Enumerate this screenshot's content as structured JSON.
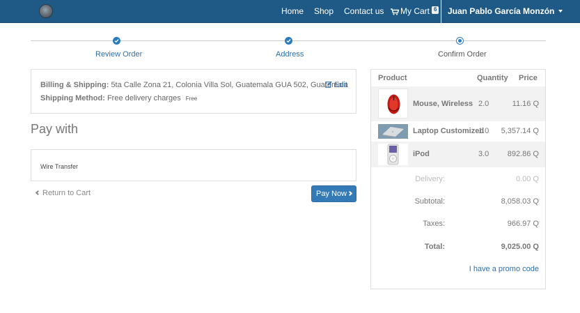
{
  "navbar": {
    "brand_icon": "logo-icon",
    "links": {
      "home": "Home",
      "shop": "Shop",
      "contact": "Contact us",
      "cart": "My Cart",
      "cart_count": "6"
    },
    "user": "Juan Pablo García Monzón",
    "colors": {
      "background": "#1f5a87",
      "text": "#ffffff"
    }
  },
  "wizard": {
    "steps": [
      {
        "label": "Review Order",
        "state": "done"
      },
      {
        "label": "Address",
        "state": "done"
      },
      {
        "label": "Confirm Order",
        "state": "current"
      }
    ],
    "accent": "#2b7bbf"
  },
  "billing": {
    "shipping_label": "Billing & Shipping:",
    "shipping_address": "5ta Calle Zona 21, Colonia Villa Sol, Guatemala GUA 502, Guatemala",
    "method_label": "Shipping Method:",
    "method_value": "Free delivery charges",
    "method_price": "Free",
    "edit_label": "Edit"
  },
  "payment": {
    "heading": "Pay with",
    "options": [
      {
        "label": "Wire Transfer"
      }
    ],
    "return_label": "Return to Cart",
    "pay_label": "Pay Now"
  },
  "summary": {
    "headers": {
      "product": "Product",
      "quantity": "Quantity",
      "price": "Price"
    },
    "items": [
      {
        "name": "Mouse, Wireless",
        "quantity": "2.0",
        "price": "11.16 Q",
        "image": "red-wireless-mouse"
      },
      {
        "name": "Laptop Customized",
        "quantity": "1.0",
        "price": "5,357.14 Q",
        "image": "laptop"
      },
      {
        "name": "iPod",
        "quantity": "3.0",
        "price": "892.86 Q",
        "image": "ipod"
      }
    ],
    "totals": {
      "delivery_label": "Delivery:",
      "delivery_value": "0.00 Q",
      "subtotal_label": "Subtotal:",
      "subtotal_value": "8,058.03 Q",
      "taxes_label": "Taxes:",
      "taxes_value": "966.97 Q",
      "total_label": "Total:",
      "total_value": "9,025.00 Q"
    },
    "promo_label": "I have a promo code"
  }
}
